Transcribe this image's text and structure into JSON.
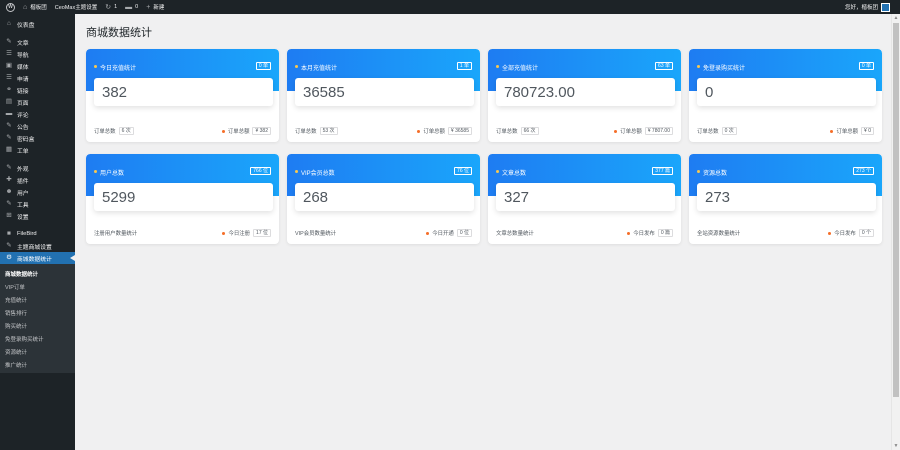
{
  "adminbar": {
    "site_name": "楷板团",
    "theme_settings": "CeoMax主题设置",
    "updates_count": "1",
    "comments_count": "0",
    "new_label": "新建",
    "greeting": "您好，楷板团"
  },
  "sidebar": {
    "items": [
      {
        "icon": "⌂",
        "label": "仪表盘"
      },
      {
        "icon": "✎",
        "label": "文章"
      },
      {
        "icon": "☰",
        "label": "导航"
      },
      {
        "icon": "▣",
        "label": "媒体"
      },
      {
        "icon": "☰",
        "label": "申请"
      },
      {
        "icon": "⚭",
        "label": "链接"
      },
      {
        "icon": "▤",
        "label": "页面"
      },
      {
        "icon": "▬",
        "label": "评论"
      },
      {
        "icon": "✎",
        "label": "公告"
      },
      {
        "icon": "✎",
        "label": "密码盒"
      },
      {
        "icon": "▦",
        "label": "工单"
      },
      {
        "icon": "✎",
        "label": "外观"
      },
      {
        "icon": "✚",
        "label": "插件"
      },
      {
        "icon": "☻",
        "label": "用户"
      },
      {
        "icon": "✎",
        "label": "工具"
      },
      {
        "icon": "⊞",
        "label": "设置"
      },
      {
        "icon": "■",
        "label": "FileBird"
      },
      {
        "icon": "✎",
        "label": "主题商城设置"
      },
      {
        "icon": "⚙",
        "label": "商城数据统计"
      }
    ],
    "submenu": [
      "商城数据统计",
      "VIP订单",
      "充值统计",
      "销售排行",
      "购买统计",
      "免登录购买统计",
      "资源统计",
      "推广统计"
    ]
  },
  "page": {
    "title": "商城数据统计"
  },
  "cards": [
    {
      "title": "今日充值统计",
      "badge": "0 单",
      "value": "382",
      "left_label": "订单总数",
      "left_tag": "6 次",
      "right_label": "订单总额",
      "right_tag": "¥ 382"
    },
    {
      "title": "本月充值统计",
      "badge": "1 单",
      "value": "36585",
      "left_label": "订单总数",
      "left_tag": "53 次",
      "right_label": "订单总额",
      "right_tag": "¥ 36585"
    },
    {
      "title": "全部充值统计",
      "badge": "63 单",
      "value": "780723.00",
      "left_label": "订单总数",
      "left_tag": "66 次",
      "right_label": "订单总额",
      "right_tag": "¥ 7807.00"
    },
    {
      "title": "免登录购买统计",
      "badge": "0 单",
      "value": "0",
      "left_label": "订单总数",
      "left_tag": "0 次",
      "right_label": "订单总额",
      "right_tag": "¥ 0"
    },
    {
      "title": "用户总数",
      "badge": "766 位",
      "value": "5299",
      "left_label": "注册用户数量统计",
      "left_tag": "",
      "right_label": "今日注册",
      "right_tag": "17 位"
    },
    {
      "title": "VIP会员总数",
      "badge": "76 位",
      "value": "268",
      "left_label": "VIP会员数量统计",
      "left_tag": "",
      "right_label": "今日开通",
      "right_tag": "0 位"
    },
    {
      "title": "文章总数",
      "badge": "377 篇",
      "value": "327",
      "left_label": "文章总数量统计",
      "left_tag": "",
      "right_label": "今日发布",
      "right_tag": "0 篇"
    },
    {
      "title": "资源总数",
      "badge": "273 个",
      "value": "273",
      "left_label": "全站资源数量统计",
      "left_tag": "",
      "right_label": "今日发布",
      "right_tag": "0 个"
    }
  ],
  "colors": {
    "card_gradient_start": "#1e7cf2",
    "card_gradient_end": "#1aa6fb",
    "menu_current": "#2271b1",
    "accent_dot": "#f56e28"
  }
}
